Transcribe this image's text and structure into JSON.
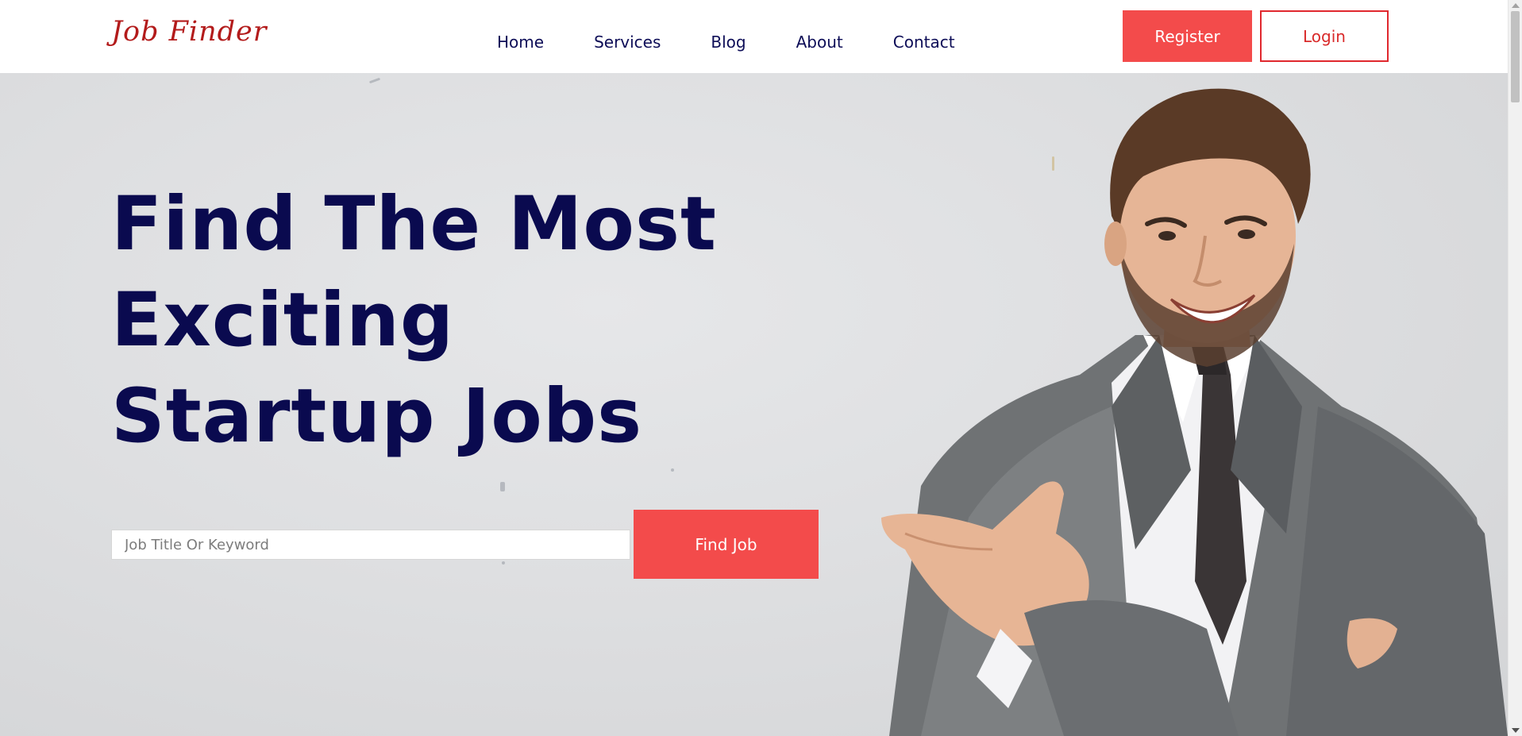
{
  "header": {
    "logo": "Job Finder",
    "nav": [
      {
        "label": "Home"
      },
      {
        "label": "Services"
      },
      {
        "label": "Blog"
      },
      {
        "label": "About"
      },
      {
        "label": "Contact"
      }
    ],
    "register_label": "Register",
    "login_label": "Login"
  },
  "hero": {
    "title_lines": [
      "Find The Most",
      "Exciting",
      "Startup Jobs"
    ],
    "search_placeholder": "Job Title Or Keyword",
    "search_value": "",
    "find_button_label": "Find Job"
  },
  "icons": {
    "hero_image": "smiling-businessman-illustration"
  },
  "colors": {
    "accent": "#f34b4b",
    "logo": "#b31b1b",
    "heading": "#0a0a4f",
    "nav": "#0d0d57",
    "login_border": "#e0282e"
  }
}
